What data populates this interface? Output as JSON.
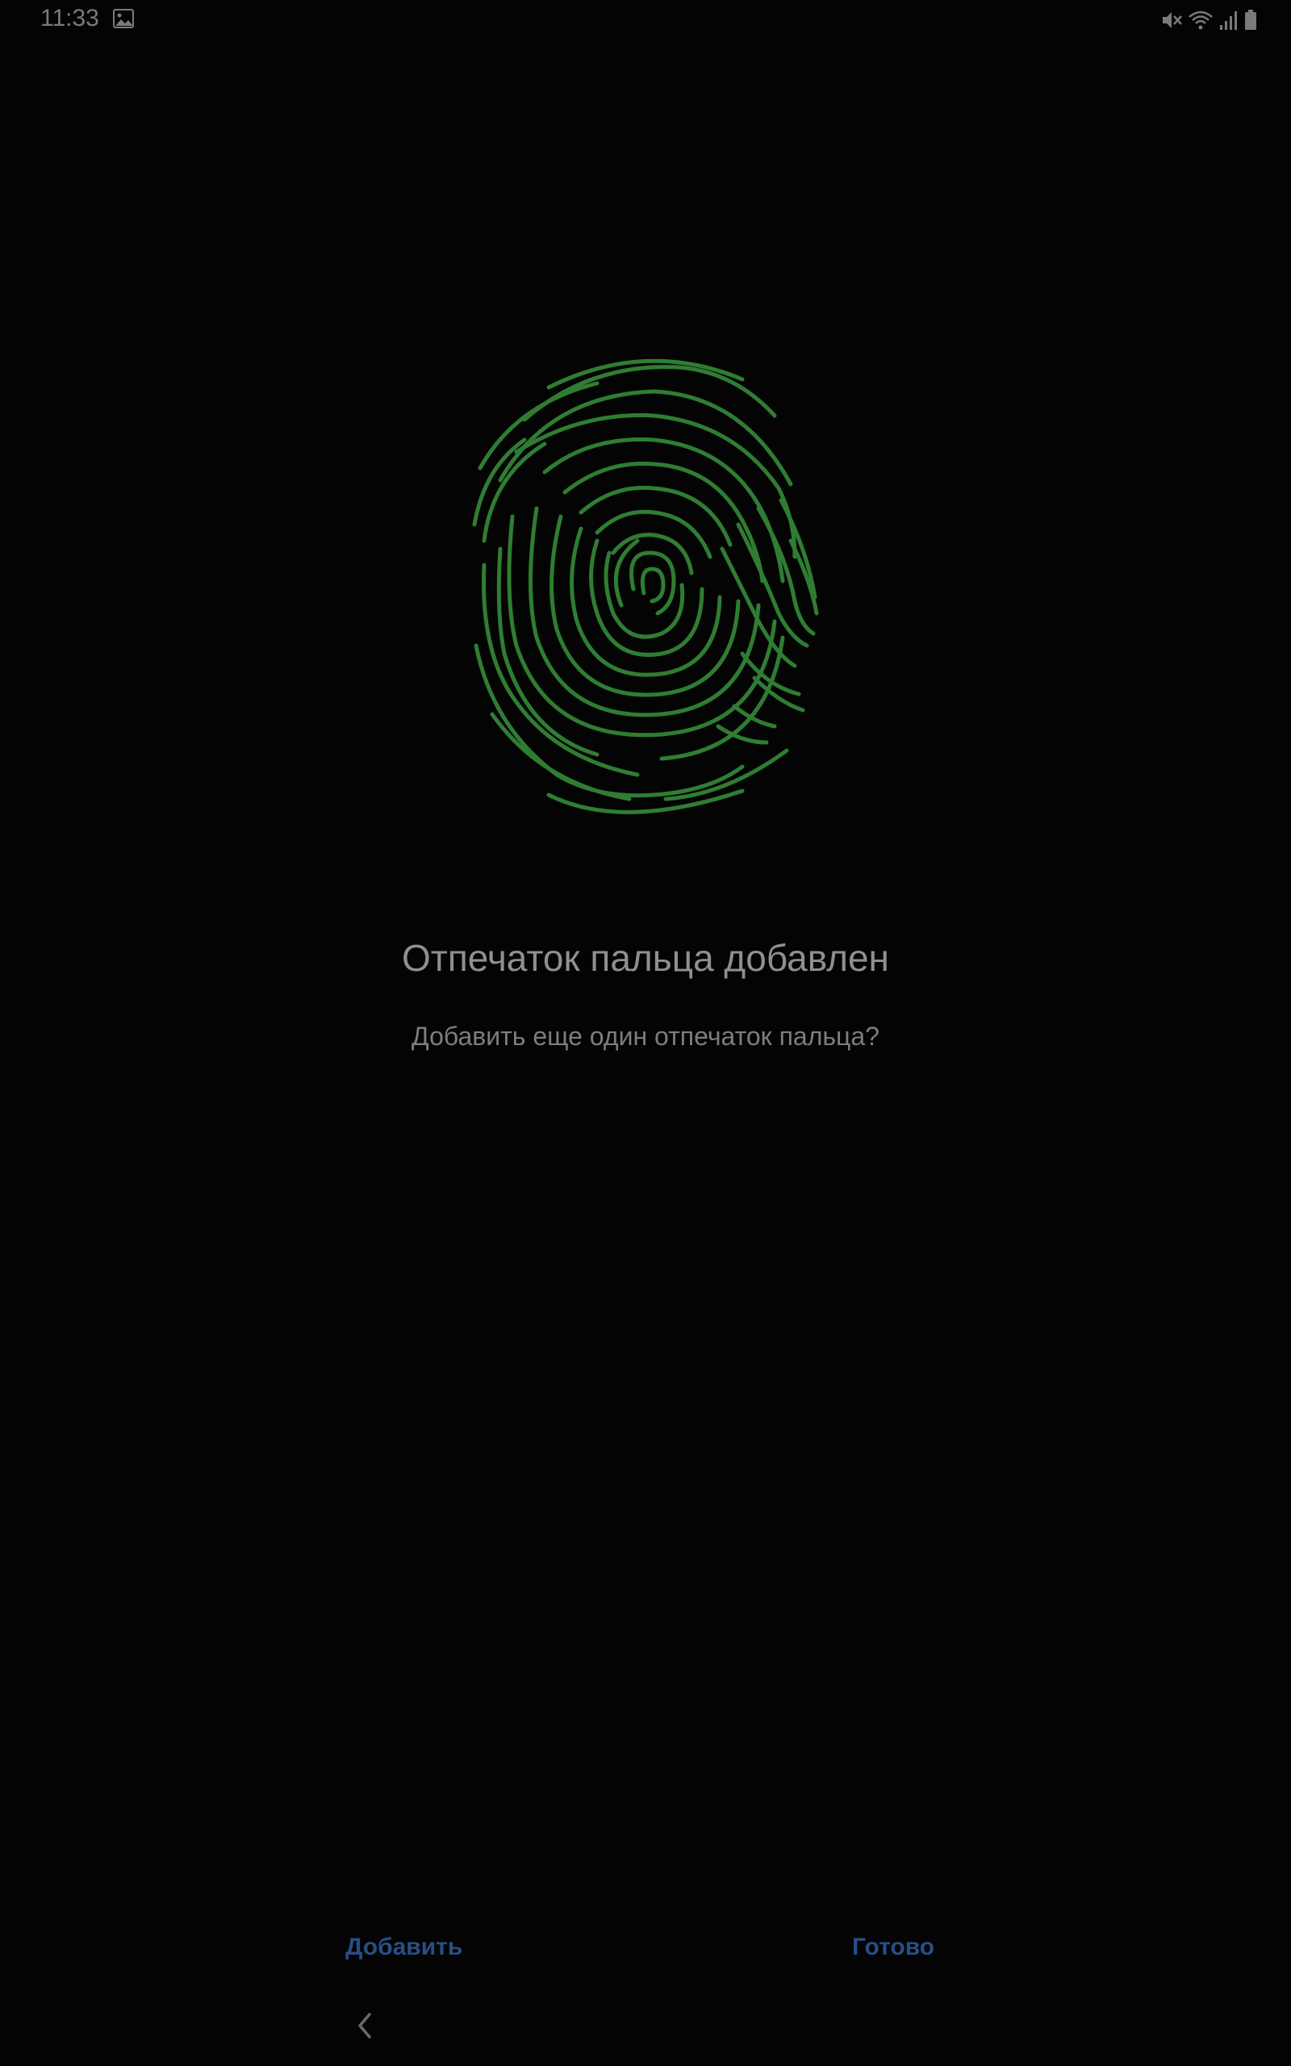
{
  "status_bar": {
    "time": "11:33",
    "icons": [
      "gallery-icon",
      "mute-icon",
      "wifi-icon",
      "signal-icon",
      "battery-icon"
    ]
  },
  "fingerprint": {
    "icon": "fingerprint-icon",
    "color": "#2f7d32"
  },
  "main": {
    "title": "Отпечаток пальца добавлен",
    "subtitle": "Добавить еще один отпечаток пальца?"
  },
  "actions": {
    "add_label": "Добавить",
    "done_label": "Готово",
    "accent_color": "#274f86"
  },
  "navigation": {
    "back_icon": "back-chevron-icon"
  }
}
